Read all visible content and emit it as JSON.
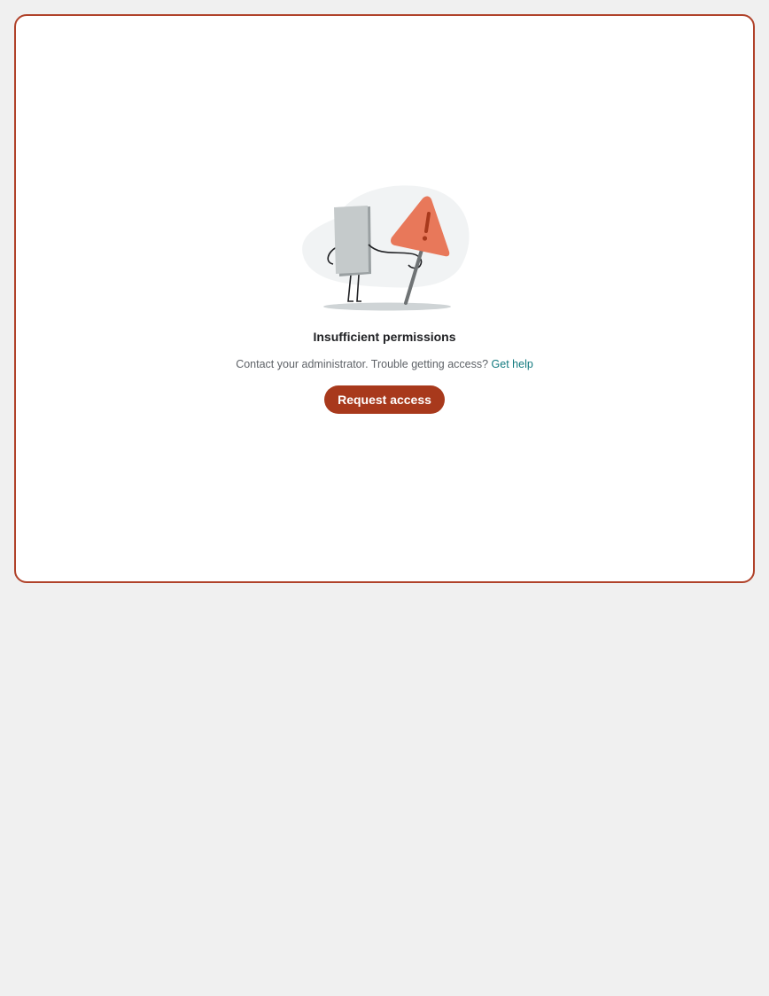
{
  "empty_state": {
    "title": "Insufficient permissions",
    "message": "Contact your administrator. Trouble getting access?",
    "help_link_label": "Get help",
    "action_button_label": "Request access",
    "illustration_icon": "warning-sign-character-icon"
  },
  "colors": {
    "page_background": "#f0f0f0",
    "card_border": "#b0422a",
    "button_background": "#a8391c",
    "link": "#137a7f",
    "warning_triangle": "#e8785a"
  }
}
